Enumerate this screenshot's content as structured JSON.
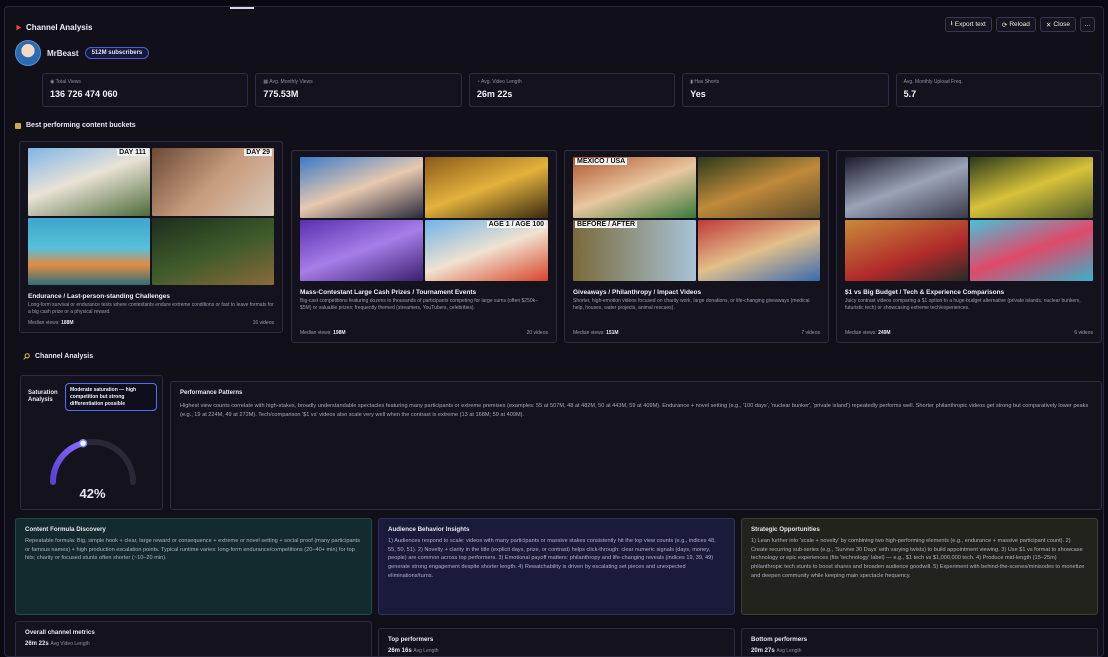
{
  "header": {
    "title": "Channel Analysis",
    "export_label": "Export text",
    "reload_label": "Reload",
    "close_label": "Close",
    "more_label": "..."
  },
  "channel": {
    "name": "MrBeast",
    "subscribers": "512M subscribers"
  },
  "stats": [
    {
      "label": "Total Views",
      "value": "136 726 474 060"
    },
    {
      "label": "Avg. Monthly Views",
      "value": "775.53M"
    },
    {
      "label": "Avg. Video Length",
      "value": "26m 22s"
    },
    {
      "label": "Has Shorts",
      "value": "Yes"
    },
    {
      "label": "Avg. Monthly Upload Freq.",
      "value": "5.7"
    }
  ],
  "buckets_title": "Best performing content buckets",
  "buckets": [
    {
      "title": "Endurance / Last-person-standing Challenges",
      "desc": "Long-form survival or endurance tests where contestants endure extreme conditions or fast to leave formats for a big cash prize or a physical reward.",
      "median_label": "Median views:",
      "median_value": "188M",
      "count": "16 videos",
      "overlays": [
        "DAY 111",
        "DAY 29",
        "",
        ""
      ]
    },
    {
      "title": "Mass-Contestant Large Cash Prizes / Tournament Events",
      "desc": "Big-cast competitions featuring dozens to thousands of participants competing for large sums (often $250k–$5M) or valuable prizes; frequently themed (streamers, YouTubers, celebrities).",
      "median_label": "Median views:",
      "median_value": "198M",
      "count": "20 videos",
      "overlays": [
        "",
        "",
        "",
        "AGE 1 / AGE 100"
      ]
    },
    {
      "title": "Giveaways / Philanthropy / Impact Videos",
      "desc": "Shorter, high-emotion videos focused on charity work, large donations, or life-changing giveaways (medical help, houses, water projects, animal rescues).",
      "median_label": "Median views:",
      "median_value": "151M",
      "count": "7 videos",
      "overlays": [
        "MEXICO / USA",
        "",
        "BEFORE / AFTER",
        ""
      ]
    },
    {
      "title": "$1 vs Big Budget / Tech & Experience Comparisons",
      "desc": "Juicy contrast videos comparing a $1 option to a huge-budget alternative (private islands, nuclear bunkers, futuristic tech) or showcasing extreme tech/experiences.",
      "median_label": "Median views:",
      "median_value": "249M",
      "count": "6 videos",
      "overlays": [
        "",
        "",
        "",
        ""
      ]
    }
  ],
  "analysis_title": "Channel Analysis",
  "saturation": {
    "label": "Saturation Analysis",
    "chip": "Moderate saturation — high competition but strong differentiation possible",
    "percent_text": "42%",
    "percent_value": 0.42
  },
  "performance": {
    "title": "Performance Patterns",
    "text": "Highest view counts correlate with high-stakes, broadly understandable spectacles featuring many participants or extreme premises (examples: 55 at 507M, 48 at 482M, 50 at 443M, 59 at 409M). Endurance + novel setting (e.g., '100 days', 'nuclear bunker', 'private island') repeatedly performs well. Shorter philanthropic videos get strong but comparatively lower peaks (e.g., 19 at 224M, 49 at 272M). Tech/comparison '$1 vs' videos also scale very well when the contrast is extreme (13 at 168M; 59 at 409M)."
  },
  "insights": [
    {
      "title": "Content Formula Discovery",
      "text": "Repeatable formula: Big, simple hook + clear, large reward or consequence + extreme or novel setting + social proof (many participants or famous names) + high production escalation points. Typical runtime varies: long-form endurance/competitions (20–40+ min) for top hits; charity or focused stunts often shorter (~10–20 min)."
    },
    {
      "title": "Audience Behavior Insights",
      "text": "1) Audiences respond to scale: videos with many participants or massive stakes consistently hit the top view counts (e.g., indices 48, 55, 50, 51). 2) Novelty + clarity in the title (explicit days, prize, or contrast) helps click-through: clear numeric signals (days, money, people) are common across top performers. 3) Emotional payoff matters: philanthropy and life-changing reveals (indices 19, 39, 49) generate strong engagement despite shorter length. 4) Rewatchability is driven by escalating set pieces and unexpected eliminations/turns."
    },
    {
      "title": "Strategic Opportunities",
      "text": "1) Lean further into 'scale + novelty' by combining two high-performing elements (e.g., endurance + massive participant count). 2) Create recurring sub-series (e.g., 'Survive 30 Days' with varying twists) to build appointment viewing. 3) Use $1 vs format to showcase technology or epic experiences (fits 'technology' label) — e.g., $1 tech vs $1,000,000 tech. 4) Produce mid-length (15–25m) philanthropic tech stunts to boost shares and broaden audience goodwill. 5) Experiment with behind-the-scenes/minisodes to monetize and deepen community while keeping main spectacle frequency."
    }
  ],
  "bottom_cards": [
    {
      "title": "Overall channel metrics",
      "value": "26m 22s",
      "unit": "Avg Video Length"
    },
    {
      "title": "Top performers",
      "value": "26m 16s",
      "unit": "Avg Length"
    },
    {
      "title": "Bottom performers",
      "value": "20m 27s",
      "unit": "Avg Length"
    }
  ],
  "colors": {
    "accent": "#5a6cff",
    "gauge_start": "#5b3fd6",
    "gauge_end": "#8a6bff",
    "formula_bg": "#132b2e",
    "audience_bg": "#1a1a3a",
    "strategy_bg": "#22231c"
  }
}
